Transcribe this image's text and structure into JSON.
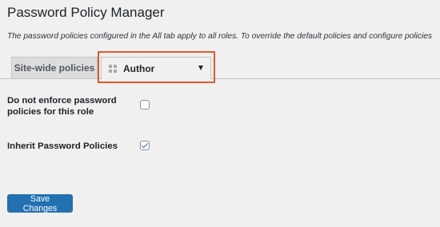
{
  "page": {
    "title": "Password Policy Manager",
    "description": "The password policies configured in the All tab apply to all roles. To override the default policies and configure policies"
  },
  "tabs": {
    "site_wide_label": "Site-wide policies",
    "role_select": {
      "selected": "Author",
      "icon": "grid-icon"
    }
  },
  "highlight_color": "#e05a2a",
  "settings": {
    "enforce": {
      "label": "Do not enforce password policies for this role",
      "checked": false
    },
    "inherit": {
      "label": "Inherit Password Policies",
      "checked": true
    }
  },
  "actions": {
    "save_label": "Save Changes"
  },
  "colors": {
    "primary": "#2271b1",
    "background": "#f0f0f1"
  }
}
